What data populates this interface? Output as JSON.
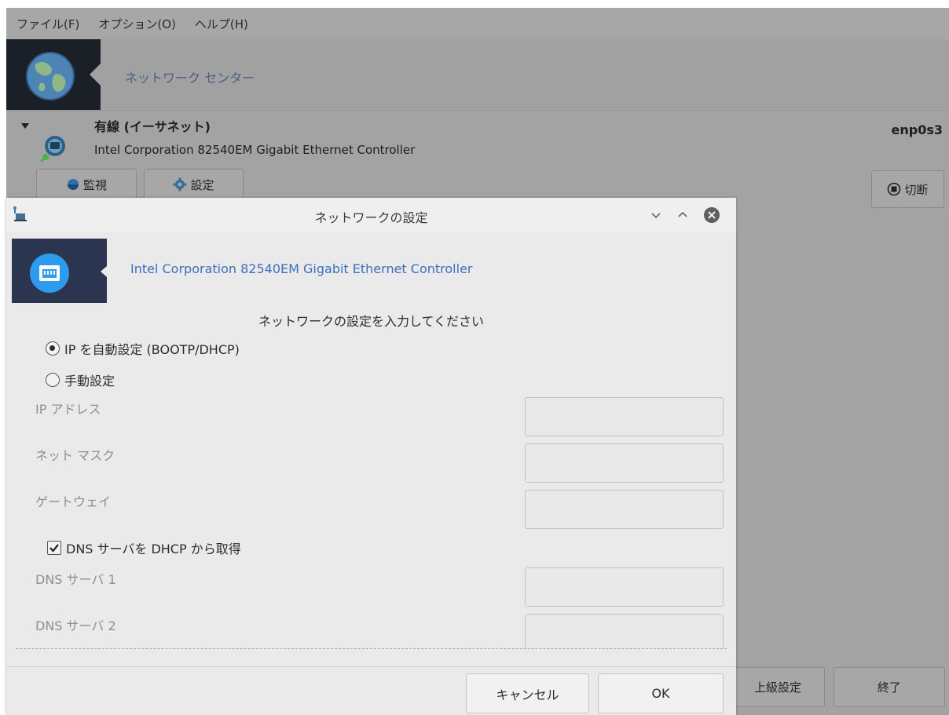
{
  "menubar": {
    "items": [
      {
        "label": "ファイル(F)"
      },
      {
        "label": "オプション(O)"
      },
      {
        "label": "ヘルプ(H)"
      }
    ]
  },
  "main": {
    "title": "ネットワーク センター",
    "connection": {
      "type_label": "有線 (イーサネット)",
      "device": "Intel Corporation 82540EM Gigabit Ethernet Controller",
      "interface": "enp0s3"
    },
    "buttons": {
      "monitor": "監視",
      "settings": "設定",
      "disconnect": "切断",
      "advanced": "上級設定",
      "quit": "終了"
    }
  },
  "dialog": {
    "title": "ネットワークの設定",
    "subtitle": "Intel Corporation 82540EM Gigabit Ethernet Controller",
    "instruction": "ネットワークの設定を入力してください",
    "radio_auto": {
      "label": "IP を自動設定 (BOOTP/DHCP)",
      "checked": true
    },
    "radio_manual": {
      "label": "手動設定",
      "checked": false
    },
    "fields": {
      "ip_label": "IP アドレス",
      "ip_value": "",
      "netmask_label": "ネット マスク",
      "netmask_value": "",
      "gateway_label": "ゲートウェイ",
      "gateway_value": "",
      "dns1_label": "DNS サーバ 1",
      "dns1_value": "",
      "dns2_label": "DNS サーバ 2",
      "dns2_value": ""
    },
    "dns_checkbox": {
      "label": "DNS サーバを DHCP から取得",
      "checked": true
    },
    "buttons": {
      "cancel": "キャンセル",
      "ok": "OK"
    }
  },
  "colors": {
    "accent_link": "#3b6fbd",
    "dim_background": "#a3a3a3",
    "dialog_background": "#eaeaea",
    "header_icon_bg": "#1b1f27",
    "dialog_icon_bg": "#2b3550"
  },
  "icons": {
    "app": "globe-icon",
    "connection": "wired-connection-icon",
    "monitor": "monitor-icon",
    "settings": "gear-icon",
    "disconnect": "disconnect-icon",
    "dialog_app": "network-app-icon",
    "dialog_header": "ethernet-port-icon"
  }
}
